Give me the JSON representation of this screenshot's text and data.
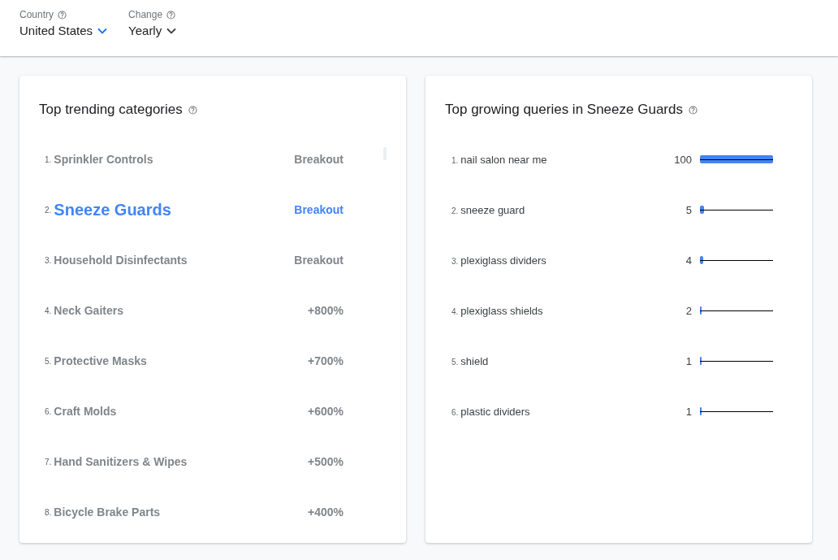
{
  "filters": [
    {
      "label": "Country",
      "value": "United States"
    },
    {
      "label": "Change",
      "value": "Yearly"
    }
  ],
  "categories": {
    "title": "Top trending categories",
    "items": [
      {
        "rank": "1.",
        "name": "Sprinkler Controls",
        "change": "Breakout",
        "selected": false
      },
      {
        "rank": "2.",
        "name": "Sneeze Guards",
        "change": "Breakout",
        "selected": true
      },
      {
        "rank": "3.",
        "name": "Household Disinfectants",
        "change": "Breakout",
        "selected": false
      },
      {
        "rank": "4.",
        "name": "Neck Gaiters",
        "change": "+800%",
        "selected": false
      },
      {
        "rank": "5.",
        "name": "Protective Masks",
        "change": "+700%",
        "selected": false
      },
      {
        "rank": "6.",
        "name": "Craft Molds",
        "change": "+600%",
        "selected": false
      },
      {
        "rank": "7.",
        "name": "Hand Sanitizers & Wipes",
        "change": "+500%",
        "selected": false
      },
      {
        "rank": "8.",
        "name": "Bicycle Brake Parts",
        "change": "+400%",
        "selected": false
      }
    ]
  },
  "queries": {
    "title": "Top growing queries in Sneeze Guards",
    "items": [
      {
        "rank": "1.",
        "query": "nail salon near me",
        "reading": "100",
        "level": 1
      },
      {
        "rank": "2.",
        "query": "sneeze guard",
        "reading": "5",
        "level": 0.05
      },
      {
        "rank": "3.",
        "query": "plexiglass dividers",
        "reading": "4",
        "level": 0.04
      },
      {
        "rank": "4.",
        "query": "plexiglass shields",
        "reading": "2",
        "level": 0.02
      },
      {
        "rank": "5.",
        "query": "shield",
        "reading": "1",
        "level": 0.01
      },
      {
        "rank": "6.",
        "query": "plastic dividers",
        "reading": "1",
        "level": 0.01
      }
    ]
  }
}
